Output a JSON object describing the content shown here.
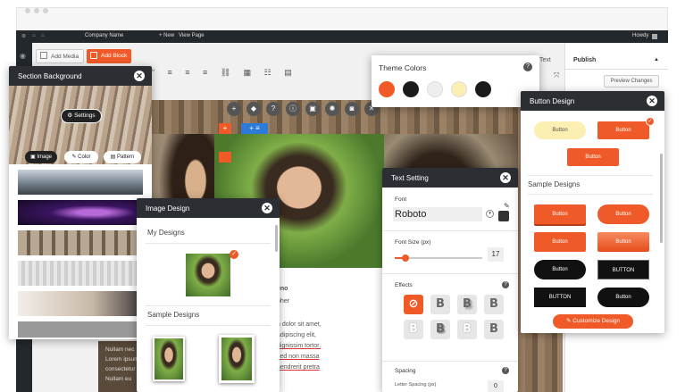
{
  "admin_bar": {
    "company": "Company Name",
    "new": "+ New",
    "view_page": "View Page",
    "howdy": "Howdy"
  },
  "editor": {
    "add_media": "Add Media",
    "add_block": "Add Block",
    "text_tab": "Text",
    "publish": "Publish",
    "preview_changes": "Preview Changes"
  },
  "content": {
    "lines": [
      "eno",
      "pher",
      "n dolor sit amet,",
      "adipiscing elit,",
      "dignissim tortor.",
      "sed non massa",
      "hendrerit pretra",
      "ec pretra"
    ],
    "left_lines": [
      "Nullam nec",
      "Lorem ipsum",
      "consectetur",
      "Nullam eu"
    ]
  },
  "section_background": {
    "title": "Section Background",
    "settings_button": "Settings",
    "tabs": [
      "Image",
      "Color",
      "Pattern"
    ]
  },
  "image_design": {
    "title": "Image Design",
    "my_designs": "My Designs",
    "sample_designs": "Sample Designs"
  },
  "theme_colors": {
    "title": "Theme Colors",
    "colors": [
      "#f05a28",
      "#1a1a1a",
      "#eeeeee",
      "#fbefb2",
      "#1a1a1a"
    ]
  },
  "text_setting": {
    "title": "Text Setting",
    "font_label": "Font",
    "font_value": "Roboto",
    "font_size_label": "Font Size (px)",
    "font_size_value": "17",
    "effects_label": "Effects",
    "spacing_label": "Spacing",
    "letter_spacing_label": "Letter Spacing (px)",
    "letter_spacing_value": "0"
  },
  "button_design": {
    "title": "Button Design",
    "top_buttons": [
      "Button",
      "Button",
      "Button"
    ],
    "sample_designs": "Sample Designs",
    "samples": [
      "Button",
      "Button",
      "Button",
      "Button",
      "Button",
      "BUTTON",
      "BUTTON",
      "Button"
    ],
    "customize": "Customize Design"
  }
}
